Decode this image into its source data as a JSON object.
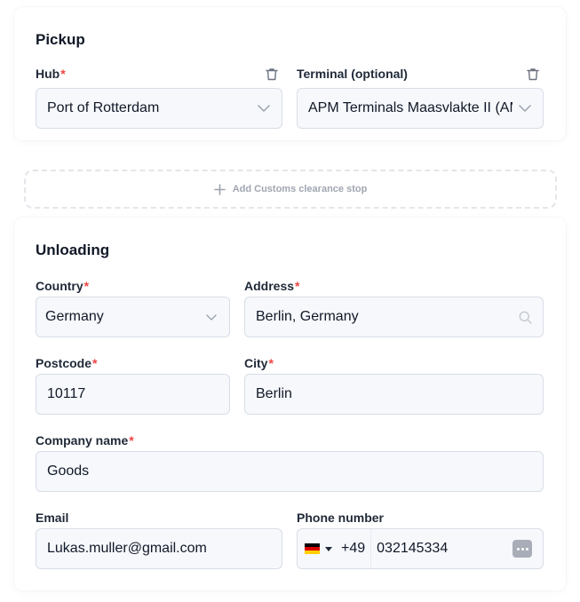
{
  "colors": {
    "required": "#ef4444",
    "field_bg": "#f6f8fc",
    "field_border": "#d8dde6",
    "muted": "#a0a6b1",
    "flag": [
      "#000000",
      "#dd0000",
      "#ffce00"
    ]
  },
  "pickup": {
    "title": "Pickup",
    "hub": {
      "label": "Hub",
      "required": "*",
      "value": "Port of Rotterdam",
      "icon": "chevron-down-icon",
      "remove_icon": "trash-icon"
    },
    "terminal": {
      "label": "Terminal (optional)",
      "value": "APM Terminals Maasvlakte II (AMS",
      "icon": "chevron-down-icon",
      "remove_icon": "trash-icon"
    }
  },
  "add_stop": {
    "icon": "plus-icon",
    "label": "Add Customs clearance stop"
  },
  "unloading": {
    "title": "Unloading",
    "country": {
      "label": "Country",
      "required": "*",
      "value": "Germany",
      "icon": "chevron-down-icon"
    },
    "address": {
      "label": "Address",
      "required": "*",
      "value": "Berlin, Germany",
      "icon": "search-icon"
    },
    "postcode": {
      "label": "Postcode",
      "required": "*",
      "value": "10117"
    },
    "city": {
      "label": "City",
      "required": "*",
      "value": "Berlin"
    },
    "company": {
      "label": "Company name",
      "required": "*",
      "value": "Goods"
    },
    "email": {
      "label": "Email",
      "value": "Lukas.muller@gmail.com"
    },
    "phone": {
      "label": "Phone number",
      "country_flag": "germany-flag-icon",
      "dial_code": "+49",
      "value": "032145334",
      "icon": "password-dots-icon"
    }
  }
}
